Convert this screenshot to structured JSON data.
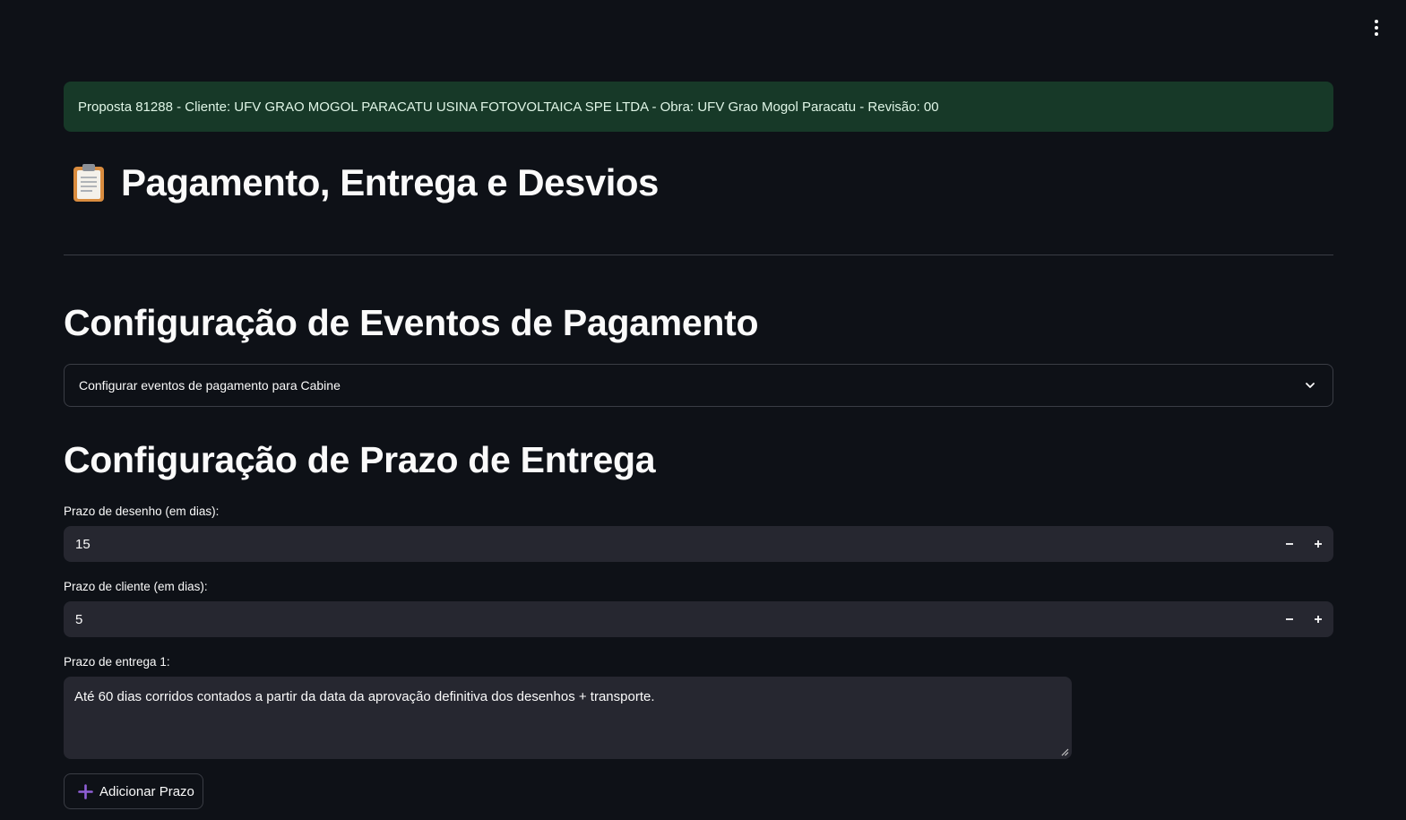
{
  "header": {
    "menu_icon": "vertical-dots-icon"
  },
  "banner": {
    "text": "Proposta 81288 - Cliente: UFV GRAO MOGOL PARACATU USINA FOTOVOLTAICA SPE LTDA - Obra: UFV Grao Mogol Paracatu - Revisão: 00",
    "color": "#173928"
  },
  "page": {
    "icon": "clipboard-icon",
    "title": "Pagamento, Entrega e Desvios"
  },
  "payment_section": {
    "title": "Configuração de Eventos de Pagamento",
    "expander_label": "Configurar eventos de pagamento para Cabine",
    "expander_icon": "chevron-down-icon"
  },
  "delivery_section": {
    "title": "Configuração de Prazo de Entrega",
    "drawing_deadline": {
      "label": "Prazo de desenho (em dias):",
      "value": "15"
    },
    "client_deadline": {
      "label": "Prazo de cliente (em dias):",
      "value": "5"
    },
    "delivery_deadline_1": {
      "label": "Prazo de entrega 1:",
      "value": "Até 60 dias corridos contados a partir da data da aprovação definitiva dos desenhos + transporte."
    },
    "add_button_label": "Adicionar Prazo",
    "add_button_icon": "plus-icon"
  },
  "colors": {
    "background": "#0e1117",
    "input_background": "#262730",
    "accent": "#8f5fd6"
  }
}
